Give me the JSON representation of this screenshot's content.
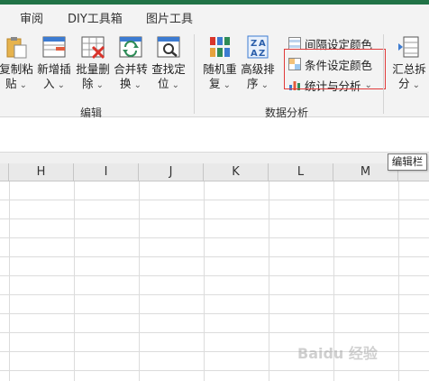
{
  "tabs": [
    "审阅",
    "DIY工具箱",
    "图片工具"
  ],
  "ribbon": {
    "edit_group": {
      "label": "编辑",
      "buttons": [
        {
          "line1": "复制粘",
          "line2": "贴"
        },
        {
          "line1": "新增插",
          "line2": "入"
        },
        {
          "line1": "批量删",
          "line2": "除"
        },
        {
          "line1": "合并转",
          "line2": "换"
        },
        {
          "line1": "查找定",
          "line2": "位"
        }
      ]
    },
    "analysis_group": {
      "label": "数据分析",
      "buttons": [
        {
          "line1": "随机重",
          "line2": "复"
        },
        {
          "line1": "高级排",
          "line2": "序"
        }
      ],
      "small_buttons": [
        "间隔设定颜色",
        "条件设定颜色",
        "统计与分析"
      ]
    },
    "summary_group": {
      "buttons": [
        {
          "line1": "汇总拆",
          "line2": "分"
        }
      ]
    }
  },
  "tooltip": "编辑栏",
  "columns": [
    "H",
    "I",
    "J",
    "K",
    "L",
    "M"
  ],
  "watermark": "Baidu 经验",
  "colors": {
    "accent": "#217346",
    "highlight_border": "#e03a3a"
  }
}
